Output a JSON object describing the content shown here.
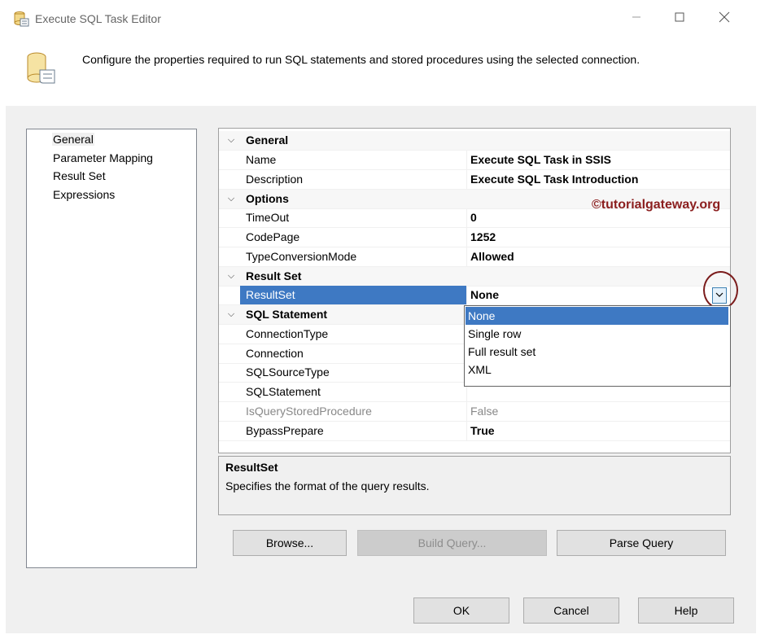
{
  "window": {
    "title": "Execute SQL Task Editor",
    "min_icon": "minimize-icon",
    "max_icon": "maximize-icon",
    "close_icon": "close-icon"
  },
  "header": {
    "description": "Configure the properties required to run SQL statements and stored procedures using the selected connection."
  },
  "nav": {
    "items": [
      {
        "label": "General"
      },
      {
        "label": "Parameter Mapping"
      },
      {
        "label": "Result Set"
      },
      {
        "label": "Expressions"
      }
    ],
    "selected": "General"
  },
  "grid": {
    "general": {
      "label": "General",
      "name_label": "Name",
      "name_value": "Execute SQL Task in SSIS",
      "desc_label": "Description",
      "desc_value": "Execute SQL Task Introduction"
    },
    "options": {
      "label": "Options",
      "timeout_label": "TimeOut",
      "timeout_value": "0",
      "codepage_label": "CodePage",
      "codepage_value": "1252",
      "tcm_label": "TypeConversionMode",
      "tcm_value": "Allowed"
    },
    "resultset": {
      "label": "Result Set",
      "rs_label": "ResultSet",
      "rs_value": "None"
    },
    "sql": {
      "label": "SQL Statement",
      "conntype_label": "ConnectionType",
      "conn_label": "Connection",
      "srctype_label": "SQLSourceType",
      "stmt_label": "SQLStatement",
      "isqsp_label": "IsQueryStoredProcedure",
      "isqsp_value": "False",
      "bypass_label": "BypassPrepare",
      "bypass_value": "True"
    }
  },
  "dropdown": {
    "options": [
      "None",
      "Single row",
      "Full result set",
      "XML"
    ],
    "selected": "None"
  },
  "watermark": "©tutorialgateway.org",
  "description_panel": {
    "title": "ResultSet",
    "text": "Specifies the format of the query results."
  },
  "buttons": {
    "browse": "Browse...",
    "build_query": "Build Query...",
    "parse_query": "Parse Query",
    "ok": "OK",
    "cancel": "Cancel",
    "help": "Help"
  },
  "colors": {
    "selection": "#3e79c3",
    "watermark": "#8b1e1e",
    "highlight_circle": "#7b1c1c"
  }
}
